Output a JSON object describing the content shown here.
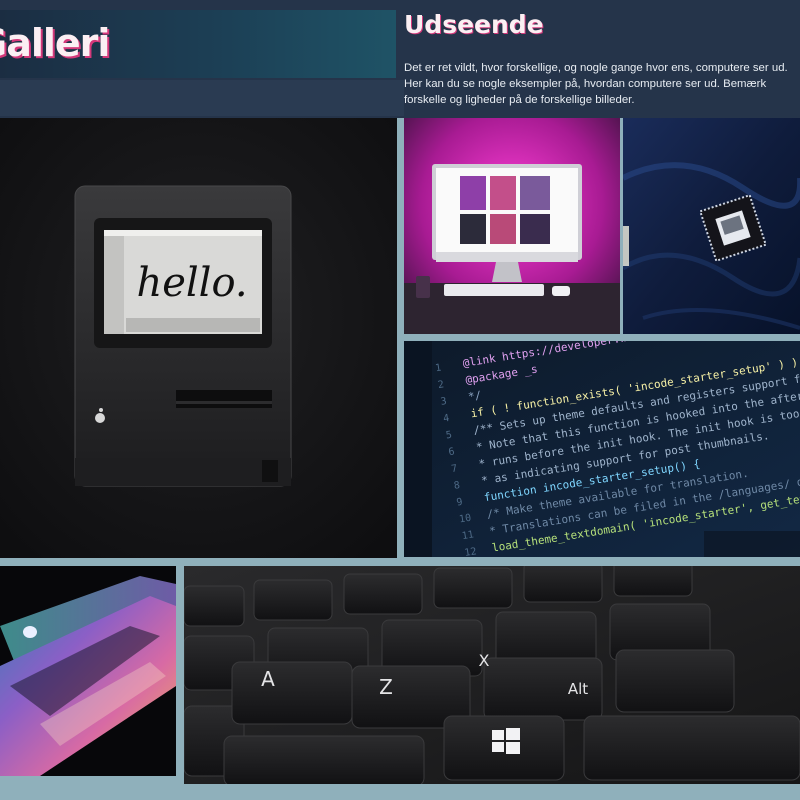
{
  "header": {
    "title": "Galleri",
    "section_title": "Udseende",
    "intro": "Det er ret vildt, hvor forskellige, og nogle gange hvor ens, computere ser ud. Her kan du se nogle eksempler på, hvordan computere ser ud. Bemærk forskelle og ligheder på de forskellige billeder."
  },
  "gallery": {
    "mac": {
      "screen_text": "hello."
    },
    "code": {
      "line_numbers": [
        "1",
        "2",
        "3",
        "4",
        "5",
        "6",
        "7",
        "8",
        "9",
        "10",
        "11",
        "12"
      ],
      "lines": [
        "@link https://developer.wordpress.org/",
        "@package _s",
        "*/",
        "if ( ! function_exists( 'incode_starter_setup' ) ) :",
        "/**  Sets up theme defaults and registers support for various WordPress",
        " * Note that this function is hooked into the after_setup_theme hook,",
        " * runs before the init hook. The init hook is too late for some featu",
        " * as indicating support for post thumbnails.",
        "function incode_starter_setup() {",
        "  /*  Make theme available for translation.",
        "   * Translations can be filed in the /languages/ directory.",
        "  load_theme_textdomain( 'incode_starter', get_template_directory() );"
      ]
    },
    "keyboard": {
      "key_a": "A",
      "key_z": "Z",
      "key_x": "X",
      "key_alt": "Alt"
    }
  },
  "colors": {
    "page_bg": "#1f2b3c",
    "gutter": "#8fb0bb",
    "title_text": "#fbeff3",
    "title_shadow": "#d4387a",
    "body_text": "#e7ecf2"
  }
}
